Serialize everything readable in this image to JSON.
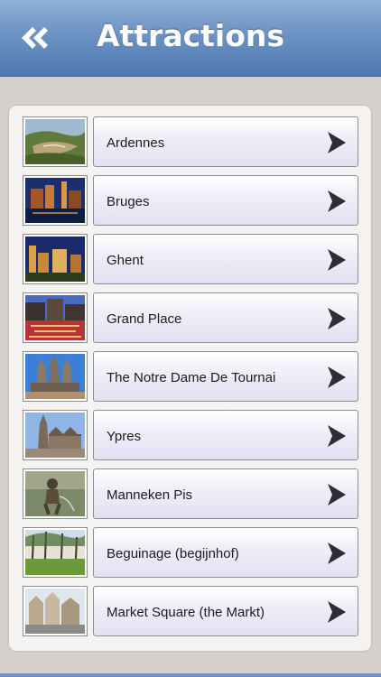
{
  "nav": {
    "title": "Attractions",
    "back_icon": "double-chevron-left-icon"
  },
  "colors": {
    "nav_top": "#8fb0d6",
    "nav_bottom": "#4f78b0",
    "background": "#d4d1cd",
    "panel": "#f4f3f1"
  },
  "attractions": [
    {
      "label": "Ardennes",
      "thumb": "valley-landscape"
    },
    {
      "label": "Bruges",
      "thumb": "canal-night"
    },
    {
      "label": "Ghent",
      "thumb": "castle-night"
    },
    {
      "label": "Grand Place",
      "thumb": "flower-carpet-square"
    },
    {
      "label": "The Notre Dame De Tournai",
      "thumb": "cathedral-towers"
    },
    {
      "label": "Ypres",
      "thumb": "cloth-hall"
    },
    {
      "label": "Manneken Pis",
      "thumb": "statue"
    },
    {
      "label": "Beguinage (begijnhof)",
      "thumb": "trees-courtyard"
    },
    {
      "label": "Market Square (the Markt)",
      "thumb": "market-buildings"
    }
  ],
  "row_chevron_icon": "chevron-right-icon"
}
